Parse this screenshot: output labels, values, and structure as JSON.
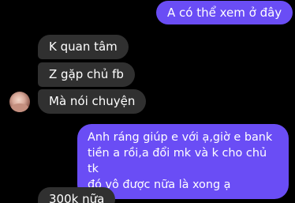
{
  "messages": {
    "out1": "A có thể xem ở đây",
    "in1": "K quan tâm",
    "in2": "Z gặp chủ fb",
    "in3": "Mà nói chuyện",
    "out2": [
      "Anh ráng giúp e với ạ,giờ e bank",
      "tiền a rồi,a đổi mk và k cho chủ tk",
      "đó vô được nữa là xong ạ"
    ],
    "in4": "300k nữa"
  },
  "colors": {
    "background": "#000000",
    "incoming_bubble": "#303030",
    "outgoing_bubble": "#6a4df5",
    "text": "#ffffff"
  }
}
